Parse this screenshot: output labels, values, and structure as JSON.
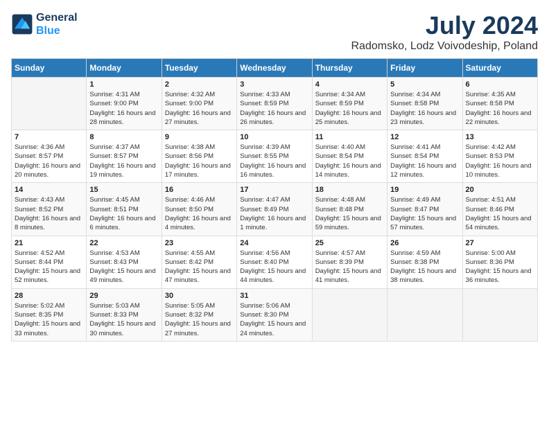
{
  "header": {
    "logo_line1": "General",
    "logo_line2": "Blue",
    "month_year": "July 2024",
    "location": "Radomsko, Lodz Voivodeship, Poland"
  },
  "weekdays": [
    "Sunday",
    "Monday",
    "Tuesday",
    "Wednesday",
    "Thursday",
    "Friday",
    "Saturday"
  ],
  "weeks": [
    [
      {
        "day": "",
        "empty": true
      },
      {
        "day": "1",
        "sunrise": "4:31 AM",
        "sunset": "9:00 PM",
        "daylight": "16 hours and 28 minutes."
      },
      {
        "day": "2",
        "sunrise": "4:32 AM",
        "sunset": "9:00 PM",
        "daylight": "16 hours and 27 minutes."
      },
      {
        "day": "3",
        "sunrise": "4:33 AM",
        "sunset": "8:59 PM",
        "daylight": "16 hours and 26 minutes."
      },
      {
        "day": "4",
        "sunrise": "4:34 AM",
        "sunset": "8:59 PM",
        "daylight": "16 hours and 25 minutes."
      },
      {
        "day": "5",
        "sunrise": "4:34 AM",
        "sunset": "8:58 PM",
        "daylight": "16 hours and 23 minutes."
      },
      {
        "day": "6",
        "sunrise": "4:35 AM",
        "sunset": "8:58 PM",
        "daylight": "16 hours and 22 minutes."
      }
    ],
    [
      {
        "day": "7",
        "sunrise": "4:36 AM",
        "sunset": "8:57 PM",
        "daylight": "16 hours and 20 minutes."
      },
      {
        "day": "8",
        "sunrise": "4:37 AM",
        "sunset": "8:57 PM",
        "daylight": "16 hours and 19 minutes."
      },
      {
        "day": "9",
        "sunrise": "4:38 AM",
        "sunset": "8:56 PM",
        "daylight": "16 hours and 17 minutes."
      },
      {
        "day": "10",
        "sunrise": "4:39 AM",
        "sunset": "8:55 PM",
        "daylight": "16 hours and 16 minutes."
      },
      {
        "day": "11",
        "sunrise": "4:40 AM",
        "sunset": "8:54 PM",
        "daylight": "16 hours and 14 minutes."
      },
      {
        "day": "12",
        "sunrise": "4:41 AM",
        "sunset": "8:54 PM",
        "daylight": "16 hours and 12 minutes."
      },
      {
        "day": "13",
        "sunrise": "4:42 AM",
        "sunset": "8:53 PM",
        "daylight": "16 hours and 10 minutes."
      }
    ],
    [
      {
        "day": "14",
        "sunrise": "4:43 AM",
        "sunset": "8:52 PM",
        "daylight": "16 hours and 8 minutes."
      },
      {
        "day": "15",
        "sunrise": "4:45 AM",
        "sunset": "8:51 PM",
        "daylight": "16 hours and 6 minutes."
      },
      {
        "day": "16",
        "sunrise": "4:46 AM",
        "sunset": "8:50 PM",
        "daylight": "16 hours and 4 minutes."
      },
      {
        "day": "17",
        "sunrise": "4:47 AM",
        "sunset": "8:49 PM",
        "daylight": "16 hours and 1 minute."
      },
      {
        "day": "18",
        "sunrise": "4:48 AM",
        "sunset": "8:48 PM",
        "daylight": "15 hours and 59 minutes."
      },
      {
        "day": "19",
        "sunrise": "4:49 AM",
        "sunset": "8:47 PM",
        "daylight": "15 hours and 57 minutes."
      },
      {
        "day": "20",
        "sunrise": "4:51 AM",
        "sunset": "8:46 PM",
        "daylight": "15 hours and 54 minutes."
      }
    ],
    [
      {
        "day": "21",
        "sunrise": "4:52 AM",
        "sunset": "8:44 PM",
        "daylight": "15 hours and 52 minutes."
      },
      {
        "day": "22",
        "sunrise": "4:53 AM",
        "sunset": "8:43 PM",
        "daylight": "15 hours and 49 minutes."
      },
      {
        "day": "23",
        "sunrise": "4:55 AM",
        "sunset": "8:42 PM",
        "daylight": "15 hours and 47 minutes."
      },
      {
        "day": "24",
        "sunrise": "4:56 AM",
        "sunset": "8:40 PM",
        "daylight": "15 hours and 44 minutes."
      },
      {
        "day": "25",
        "sunrise": "4:57 AM",
        "sunset": "8:39 PM",
        "daylight": "15 hours and 41 minutes."
      },
      {
        "day": "26",
        "sunrise": "4:59 AM",
        "sunset": "8:38 PM",
        "daylight": "15 hours and 38 minutes."
      },
      {
        "day": "27",
        "sunrise": "5:00 AM",
        "sunset": "8:36 PM",
        "daylight": "15 hours and 36 minutes."
      }
    ],
    [
      {
        "day": "28",
        "sunrise": "5:02 AM",
        "sunset": "8:35 PM",
        "daylight": "15 hours and 33 minutes."
      },
      {
        "day": "29",
        "sunrise": "5:03 AM",
        "sunset": "8:33 PM",
        "daylight": "15 hours and 30 minutes."
      },
      {
        "day": "30",
        "sunrise": "5:05 AM",
        "sunset": "8:32 PM",
        "daylight": "15 hours and 27 minutes."
      },
      {
        "day": "31",
        "sunrise": "5:06 AM",
        "sunset": "8:30 PM",
        "daylight": "15 hours and 24 minutes."
      },
      {
        "day": "",
        "empty": true
      },
      {
        "day": "",
        "empty": true
      },
      {
        "day": "",
        "empty": true
      }
    ]
  ]
}
